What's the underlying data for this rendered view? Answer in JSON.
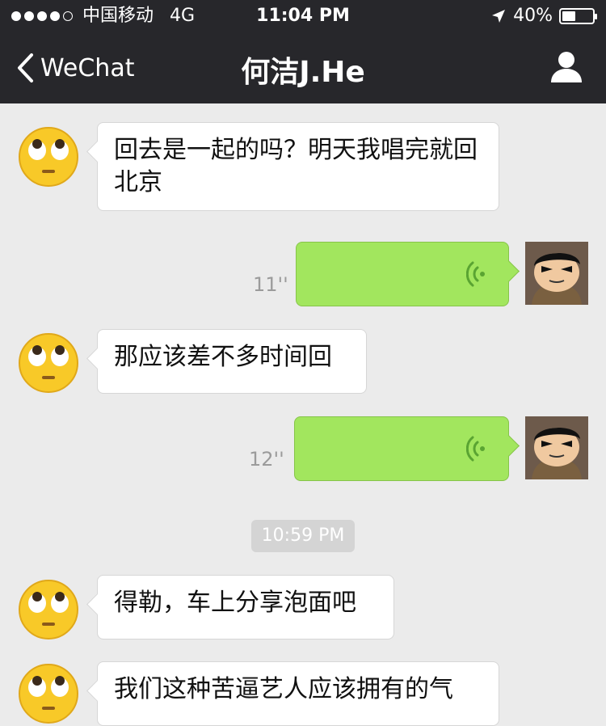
{
  "status_bar": {
    "carrier": "中国移动",
    "network": "4G",
    "time": "11:04 PM",
    "battery_percent": "40%",
    "battery_level": 0.4,
    "signal_bars_filled": 4
  },
  "nav": {
    "back_label": "WeChat",
    "title": "何洁J.He",
    "profile_icon": "person-icon"
  },
  "messages": [
    {
      "side": "left",
      "type": "text",
      "text": "回去是一起的吗？明天我唱完就回北京"
    },
    {
      "side": "right",
      "type": "voice",
      "duration": "11''"
    },
    {
      "side": "left",
      "type": "text",
      "text": "那应该差不多时间回"
    },
    {
      "side": "right",
      "type": "voice",
      "duration": "12''"
    },
    {
      "side": "center",
      "type": "timestamp",
      "text": "10:59 PM"
    },
    {
      "side": "left",
      "type": "text",
      "text": "得勒，车上分享泡面吧"
    },
    {
      "side": "left",
      "type": "text",
      "text": "我们这种苦逼艺人应该拥有的气"
    }
  ],
  "colors": {
    "nav_bg": "#27272b",
    "chat_bg": "#ebebeb",
    "voice_bubble": "#a2e65e",
    "text_bubble": "#ffffff"
  }
}
